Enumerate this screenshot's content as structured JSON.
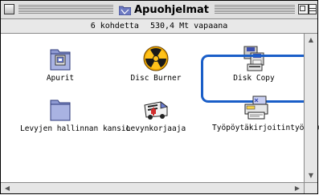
{
  "window": {
    "title": "Apuohjelmat",
    "info_items_count": "6 kohdetta",
    "info_free_space": "530,4 Mt vapaana"
  },
  "items": [
    {
      "label": "Apurit",
      "icon": "folder-with-app-icon"
    },
    {
      "label": "Disc Burner",
      "icon": "radiation-disc-icon"
    },
    {
      "label": "Disk Copy",
      "icon": "disk-copy-icon"
    },
    {
      "label": "Levyjen hallinnan kansio",
      "icon": "folder-icon"
    },
    {
      "label": "Levynkorjaaja",
      "icon": "ambulance-icon"
    },
    {
      "label": "Työpöytäkirjoitintyökalu",
      "icon": "desktop-printer-utility-icon"
    }
  ],
  "selected_item": "Työpöytäkirjoitintyökalu",
  "colors": {
    "selection": "#1a5ec8",
    "folder": "#9aa6d8",
    "window_bg": "#d6d6d6"
  }
}
